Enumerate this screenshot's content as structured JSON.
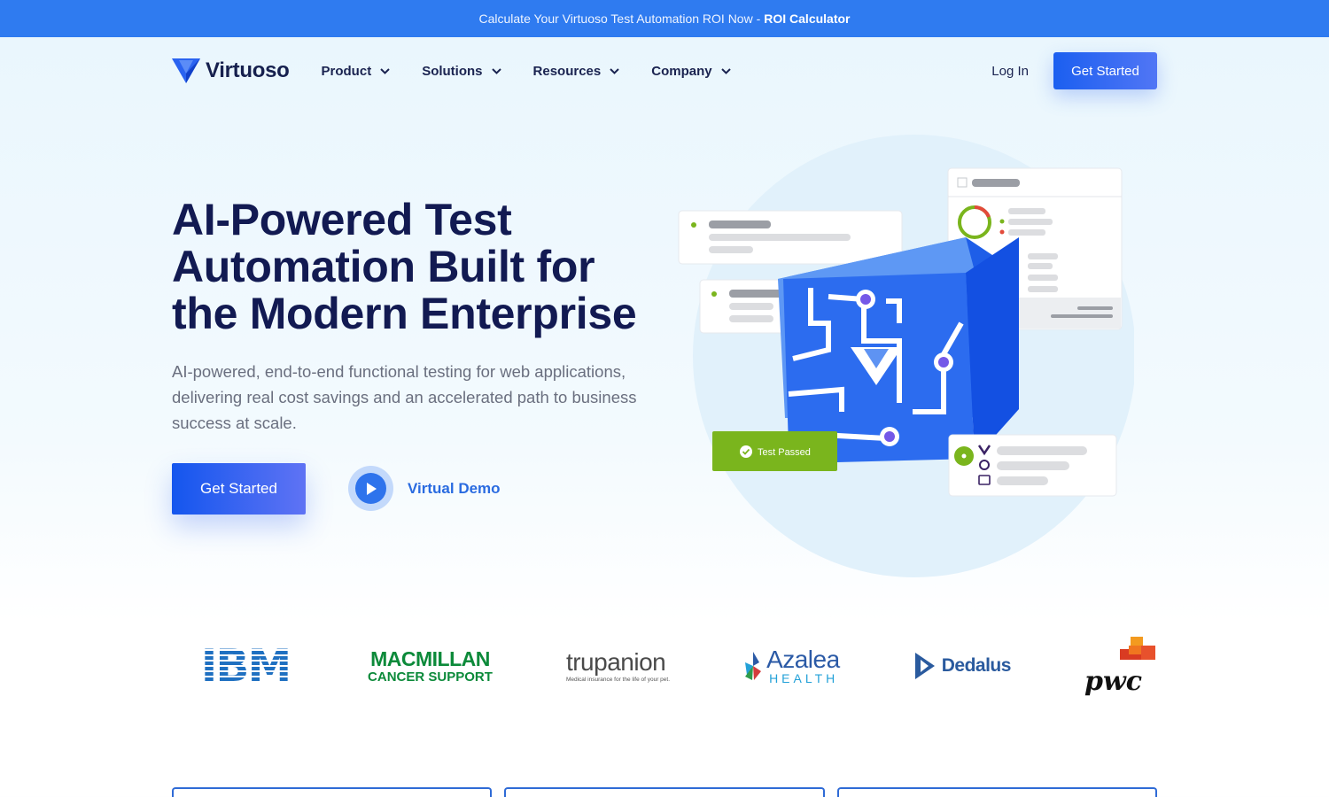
{
  "announcement": {
    "text": "Calculate Your Virtuoso Test Automation ROI Now -",
    "link": "ROI Calculator"
  },
  "nav": {
    "brand": "Virtuoso",
    "menu": [
      {
        "label": "Product"
      },
      {
        "label": "Solutions"
      },
      {
        "label": "Resources"
      },
      {
        "label": "Company"
      }
    ],
    "login": "Log In",
    "cta": "Get Started"
  },
  "hero": {
    "title": "AI-Powered Test Automation Built for the Modern Enterprise",
    "subtitle": "AI-powered, end-to-end functional testing for web applications, delivering real cost savings and an accelerated path to business success at scale.",
    "cta": "Get Started",
    "demo": "Virtual Demo"
  },
  "illustration": {
    "badge": "Test Passed"
  },
  "clients": {
    "ibm": "IBM",
    "macmillan_top": "MACMILLAN",
    "macmillan_bottom": "CANCER SUPPORT",
    "trupanion": "trupanion",
    "trupanion_tagline": "Medical insurance for the life of your pet.",
    "azalea": "Azalea",
    "azalea_sub": "HEALTH",
    "dedalus": "Dedalus",
    "pwc": "pwc"
  },
  "colors": {
    "announcement_bg": "#2f7bf0",
    "primary": "#1b5ff0",
    "heading": "#121a52",
    "success": "#7ab51d"
  }
}
